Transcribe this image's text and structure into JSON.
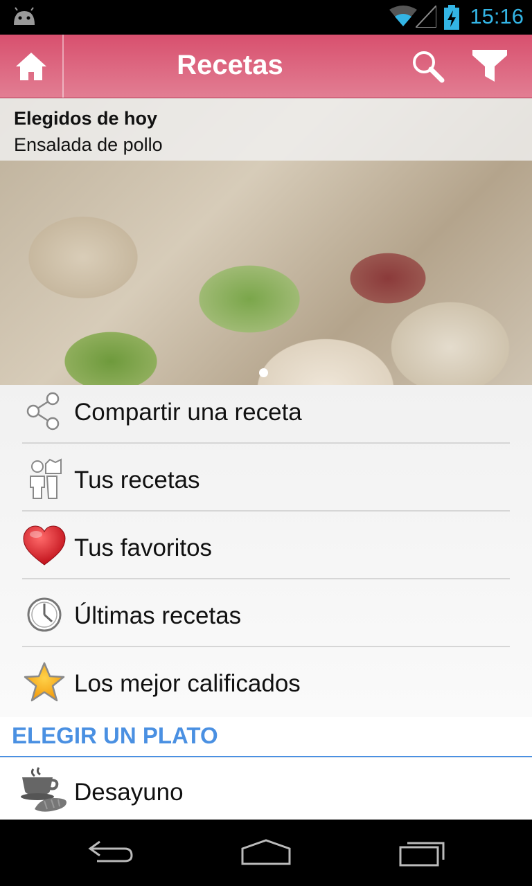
{
  "status_bar": {
    "time": "15:16"
  },
  "action_bar": {
    "title": "Recetas"
  },
  "featured": {
    "heading": "Elegidos de hoy",
    "recipe_name": "Ensalada de pollo"
  },
  "menu": {
    "items": [
      {
        "label": "Compartir una receta",
        "icon": "share-icon"
      },
      {
        "label": "Tus recetas",
        "icon": "chef-icon"
      },
      {
        "label": "Tus favoritos",
        "icon": "heart-icon"
      },
      {
        "label": "Últimas recetas",
        "icon": "clock-icon"
      },
      {
        "label": "Los mejor calificados",
        "icon": "star-icon"
      }
    ]
  },
  "section": {
    "title": "ELEGIR UN PLATO"
  },
  "categories": [
    {
      "label": "Desayuno",
      "icon": "breakfast-icon"
    }
  ],
  "colors": {
    "action_bar": "#d8506e",
    "accent": "#4a90e2",
    "clock": "#33b5e5"
  }
}
